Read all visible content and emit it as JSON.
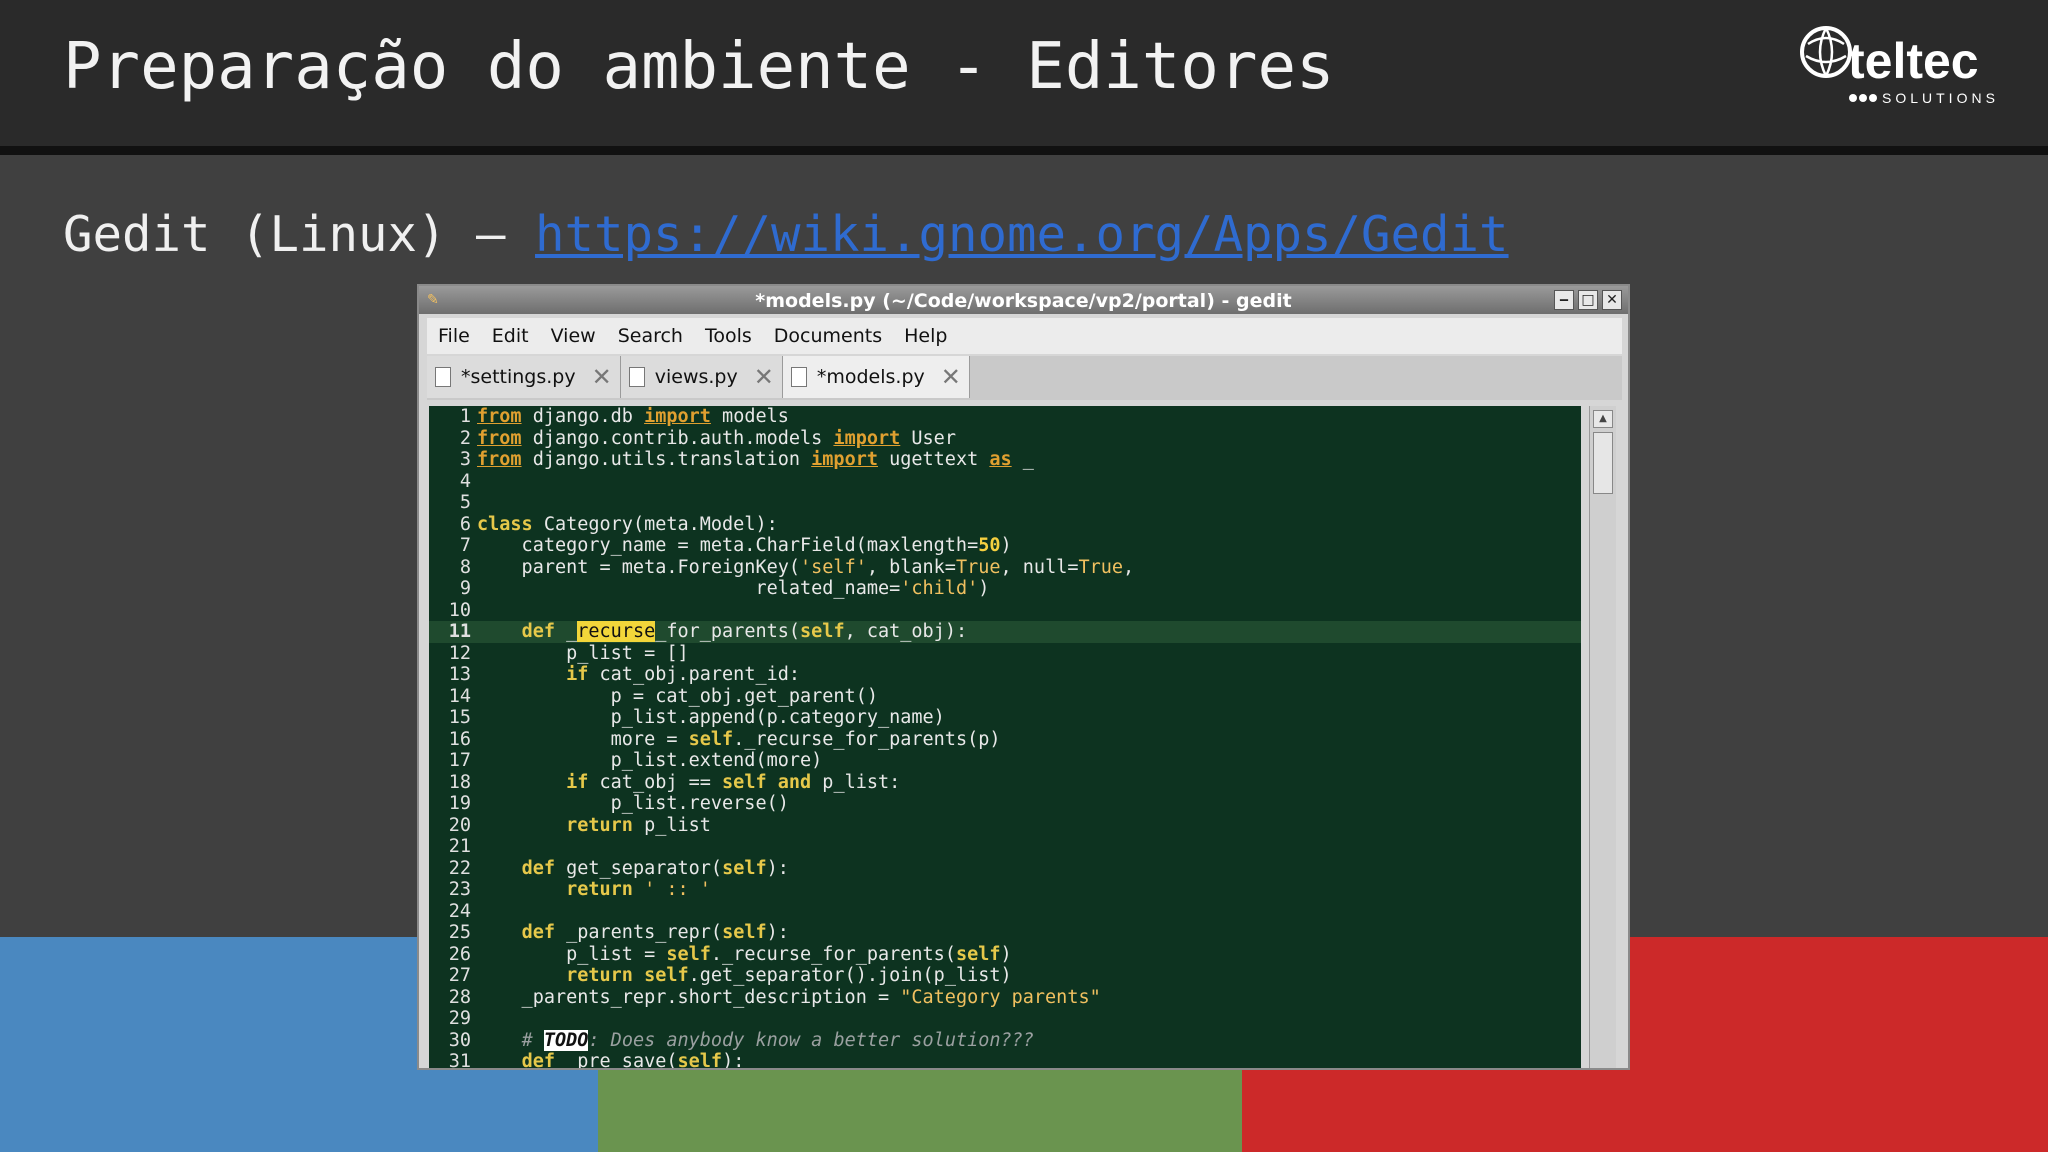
{
  "header": {
    "title": "Preparação do ambiente - Editores",
    "logo_text": "teltec",
    "logo_sub": "SOLUTIONS"
  },
  "subtitle": {
    "text": "Gedit (Linux) – ",
    "link": "https://wiki.gnome.org/Apps/Gedit"
  },
  "window": {
    "title": "*models.py (~/Code/workspace/vp2/portal) - gedit",
    "menu": [
      "File",
      "Edit",
      "View",
      "Search",
      "Tools",
      "Documents",
      "Help"
    ],
    "tabs": [
      {
        "label": "*settings.py",
        "active": false
      },
      {
        "label": "views.py",
        "active": false
      },
      {
        "label": "*models.py",
        "active": true
      }
    ],
    "current_line": 11
  },
  "code": [
    [
      1,
      [
        [
          "kw",
          "from"
        ],
        [
          "t",
          " django.db "
        ],
        [
          "kw",
          "import"
        ],
        [
          "t",
          " models"
        ]
      ]
    ],
    [
      2,
      [
        [
          "kw",
          "from"
        ],
        [
          "t",
          " django.contrib.auth.models "
        ],
        [
          "kw",
          "import"
        ],
        [
          "t",
          " User"
        ]
      ]
    ],
    [
      3,
      [
        [
          "kw",
          "from"
        ],
        [
          "t",
          " django.utils.translation "
        ],
        [
          "kw",
          "import"
        ],
        [
          "t",
          " ugettext "
        ],
        [
          "kw",
          "as"
        ],
        [
          "t",
          " _"
        ]
      ]
    ],
    [
      4,
      []
    ],
    [
      5,
      []
    ],
    [
      6,
      [
        [
          "kw2",
          "class"
        ],
        [
          "t",
          " Category(meta.Model):"
        ]
      ]
    ],
    [
      7,
      [
        [
          "t",
          "    category_name = meta.CharField(maxlength="
        ],
        [
          "num",
          "50"
        ],
        [
          "t",
          ")"
        ]
      ]
    ],
    [
      8,
      [
        [
          "t",
          "    parent = meta.ForeignKey("
        ],
        [
          "str",
          "'self'"
        ],
        [
          "t",
          ", blank="
        ],
        [
          "str",
          "True"
        ],
        [
          "t",
          ", null="
        ],
        [
          "str",
          "True"
        ],
        [
          "t",
          ","
        ]
      ]
    ],
    [
      9,
      [
        [
          "t",
          "                         related_name="
        ],
        [
          "str",
          "'child'"
        ],
        [
          "t",
          ")"
        ]
      ]
    ],
    [
      10,
      []
    ],
    [
      11,
      [
        [
          "t",
          "    "
        ],
        [
          "kw2",
          "def"
        ],
        [
          "t",
          " _"
        ],
        [
          "hl",
          "recurse"
        ],
        [
          "t",
          "_for_parents("
        ],
        [
          "kw2",
          "self"
        ],
        [
          "t",
          ", cat_obj):"
        ]
      ]
    ],
    [
      12,
      [
        [
          "t",
          "        p_list = []"
        ]
      ]
    ],
    [
      13,
      [
        [
          "t",
          "        "
        ],
        [
          "kw2",
          "if"
        ],
        [
          "t",
          " cat_obj.parent_id:"
        ]
      ]
    ],
    [
      14,
      [
        [
          "t",
          "            p = cat_obj.get_parent()"
        ]
      ]
    ],
    [
      15,
      [
        [
          "t",
          "            p_list.append(p.category_name)"
        ]
      ]
    ],
    [
      16,
      [
        [
          "t",
          "            more = "
        ],
        [
          "kw2",
          "self"
        ],
        [
          "t",
          "._recurse_for_parents(p)"
        ]
      ]
    ],
    [
      17,
      [
        [
          "t",
          "            p_list.extend(more)"
        ]
      ]
    ],
    [
      18,
      [
        [
          "t",
          "        "
        ],
        [
          "kw2",
          "if"
        ],
        [
          "t",
          " cat_obj == "
        ],
        [
          "kw2",
          "self"
        ],
        [
          "t",
          " "
        ],
        [
          "kw2",
          "and"
        ],
        [
          "t",
          " p_list:"
        ]
      ]
    ],
    [
      19,
      [
        [
          "t",
          "            p_list.reverse()"
        ]
      ]
    ],
    [
      20,
      [
        [
          "t",
          "        "
        ],
        [
          "kw2",
          "return"
        ],
        [
          "t",
          " p_list"
        ]
      ]
    ],
    [
      21,
      []
    ],
    [
      22,
      [
        [
          "t",
          "    "
        ],
        [
          "kw2",
          "def"
        ],
        [
          "t",
          " get_separator("
        ],
        [
          "kw2",
          "self"
        ],
        [
          "t",
          "):"
        ]
      ]
    ],
    [
      23,
      [
        [
          "t",
          "        "
        ],
        [
          "kw2",
          "return"
        ],
        [
          "t",
          " "
        ],
        [
          "str",
          "' :: '"
        ]
      ]
    ],
    [
      24,
      []
    ],
    [
      25,
      [
        [
          "t",
          "    "
        ],
        [
          "kw2",
          "def"
        ],
        [
          "t",
          " _parents_repr("
        ],
        [
          "kw2",
          "self"
        ],
        [
          "t",
          "):"
        ]
      ]
    ],
    [
      26,
      [
        [
          "t",
          "        p_list = "
        ],
        [
          "kw2",
          "self"
        ],
        [
          "t",
          "._recurse_for_parents("
        ],
        [
          "kw2",
          "self"
        ],
        [
          "t",
          ")"
        ]
      ]
    ],
    [
      27,
      [
        [
          "t",
          "        "
        ],
        [
          "kw2",
          "return"
        ],
        [
          "t",
          " "
        ],
        [
          "kw2",
          "self"
        ],
        [
          "t",
          ".get_separator().join(p_list)"
        ]
      ]
    ],
    [
      28,
      [
        [
          "t",
          "    _parents_repr.short_description = "
        ],
        [
          "str",
          "\"Category parents\""
        ]
      ]
    ],
    [
      29,
      []
    ],
    [
      30,
      [
        [
          "t",
          "    "
        ],
        [
          "cm",
          "# "
        ],
        [
          "todo",
          "TODO"
        ],
        [
          "cm",
          ": Does anybody know a better solution???"
        ]
      ]
    ],
    [
      31,
      [
        [
          "t",
          "    "
        ],
        [
          "kw2",
          "def"
        ],
        [
          "t",
          " _pre_save("
        ],
        [
          "kw2",
          "self"
        ],
        [
          "t",
          "):"
        ]
      ]
    ]
  ]
}
